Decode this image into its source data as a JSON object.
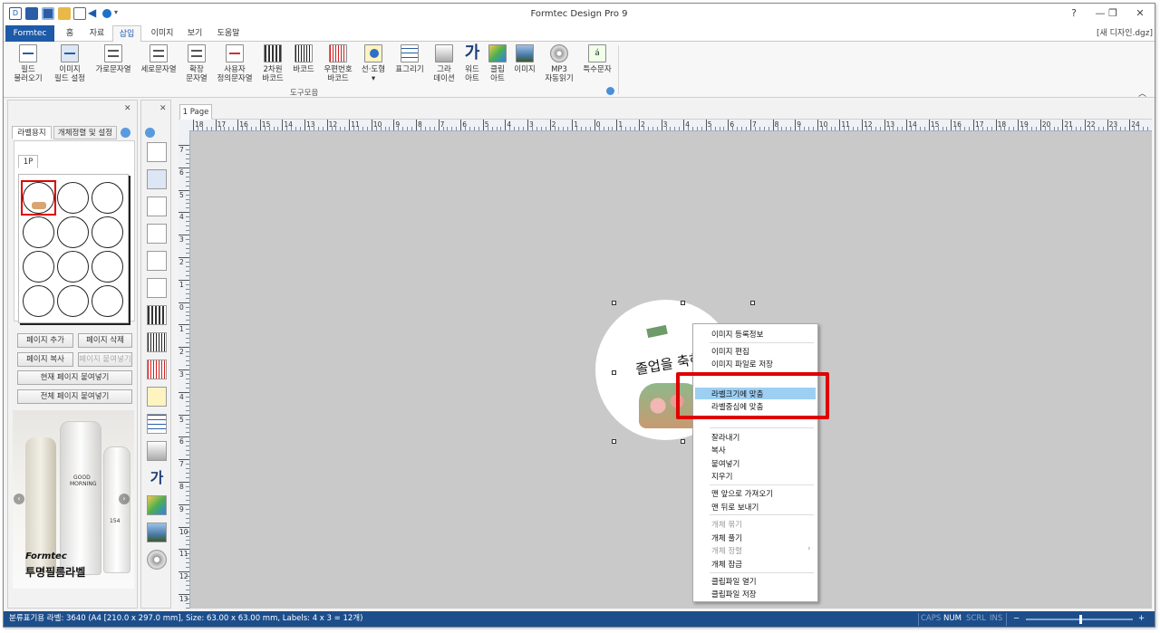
{
  "window": {
    "title": "Formtec Design Pro 9",
    "controls": [
      "?",
      "—",
      "❐",
      "✕"
    ],
    "document_name": "[새 디자인.dgz]"
  },
  "tabs": [
    {
      "label": "Formtec"
    },
    {
      "label": "홈"
    },
    {
      "label": "자료"
    },
    {
      "label": "삽입"
    },
    {
      "label": "이미지"
    },
    {
      "label": "보기"
    },
    {
      "label": "도움말"
    }
  ],
  "ribbon": {
    "buttons": [
      {
        "label1": "필드",
        "label2": "불러오기",
        "icon": "field-load-icon"
      },
      {
        "label1": "이미지",
        "label2": "필드 설정",
        "icon": "image-field-icon"
      },
      {
        "label1": "가로문자열",
        "label2": "",
        "icon": "horizontal-text-icon"
      },
      {
        "label1": "세로문자열",
        "label2": "",
        "icon": "vertical-text-icon"
      },
      {
        "label1": "확장",
        "label2": "문자열",
        "icon": "extended-text-icon"
      },
      {
        "label1": "사용자",
        "label2": "정의문자열",
        "icon": "custom-text-icon"
      },
      {
        "label1": "2차원",
        "label2": "바코드",
        "icon": "qr-code-icon"
      },
      {
        "label1": "바코드",
        "label2": "",
        "icon": "barcode-icon"
      },
      {
        "label1": "우편번호",
        "label2": "바코드",
        "icon": "postal-barcode-icon"
      },
      {
        "label1": "선·도형",
        "label2": "▾",
        "icon": "shape-icon"
      },
      {
        "label1": "표그리기",
        "label2": "",
        "icon": "table-icon"
      },
      {
        "label1": "그라",
        "label2": "데이션",
        "icon": "gradient-icon"
      },
      {
        "label1": "워드",
        "label2": "아트",
        "icon": "word-art-icon"
      },
      {
        "label1": "클립",
        "label2": "아트",
        "icon": "clip-art-icon"
      },
      {
        "label1": "이미지",
        "label2": "",
        "icon": "image-icon"
      },
      {
        "label1": "MP3",
        "label2": "자동읽기",
        "icon": "mp3-icon"
      },
      {
        "label1": "특수문자",
        "label2": "",
        "icon": "special-char-icon"
      }
    ],
    "group_label": "도구모음"
  },
  "left_panel": {
    "tabs": [
      "라벨용지",
      "개체정렬 및 설정"
    ],
    "page_tab": "1P",
    "buttons": [
      "페이지 추가",
      "페이지 삭제",
      "페이지 복사",
      "페이지 붙여넣기",
      "현재 페이지 붙여넣기",
      "전체 페이지 붙여넣기"
    ],
    "ad": {
      "brand": "Formtec",
      "caption": "투명필름라벨",
      "bottle_text1": "GOOD",
      "bottle_text2": "MORNING",
      "bottle_num": "154"
    }
  },
  "document_tab": "1 Page",
  "ruler": {
    "h_labels": [
      "18",
      "17",
      "16",
      "15",
      "14",
      "13",
      "12",
      "11",
      "10",
      "9",
      "8",
      "7",
      "6",
      "5",
      "4",
      "3",
      "2",
      "1",
      "0",
      "1",
      "2",
      "3",
      "4",
      "5",
      "6",
      "7",
      "8",
      "9",
      "10",
      "11",
      "12",
      "13",
      "14",
      "15",
      "16",
      "17",
      "18",
      "19",
      "20",
      "21",
      "22",
      "23",
      "24"
    ],
    "v_labels": [
      "7",
      "6",
      "5",
      "4",
      "3",
      "2",
      "1",
      "0",
      "1",
      "2",
      "3",
      "4",
      "5",
      "6",
      "7",
      "8",
      "9",
      "10",
      "11",
      "12",
      "13"
    ]
  },
  "label_art_text": "졸업을 축하",
  "context_menu": {
    "items": [
      {
        "label": "이미지 등록정보",
        "disabled": false
      },
      {
        "label": "이미지 편집",
        "disabled": false
      },
      {
        "label": "이미지 파일로 저장",
        "disabled": false
      },
      {
        "label": "라벨크기에 맞춤",
        "disabled": false,
        "highlighted": true
      },
      {
        "label": "라벨중심에 맞춤",
        "disabled": false
      },
      {
        "label": "잘라내기",
        "disabled": false
      },
      {
        "label": "복사",
        "disabled": false
      },
      {
        "label": "붙여넣기",
        "disabled": false
      },
      {
        "label": "지우기",
        "disabled": false
      },
      {
        "label": "맨 앞으로 가져오기",
        "disabled": false
      },
      {
        "label": "맨 뒤로 보내기",
        "disabled": false
      },
      {
        "label": "개체 묶기",
        "disabled": true
      },
      {
        "label": "개체 풀기",
        "disabled": false
      },
      {
        "label": "개체 정렬",
        "disabled": true
      },
      {
        "label": "개체 잠금",
        "disabled": false
      },
      {
        "label": "클립파일 열기",
        "disabled": false
      },
      {
        "label": "클립파일 저장",
        "disabled": false
      }
    ],
    "submenu_arrow": "›"
  },
  "status_bar": {
    "info": "분류표기용 라벨: 3640 (A4 [210.0 x 297.0 mm], Size: 63.00 x 63.00 mm,  Labels: 4 x 3 = 12개)",
    "indicators": [
      {
        "label": "CAPS",
        "active": false
      },
      {
        "label": "NUM",
        "active": true
      },
      {
        "label": "SCRL",
        "active": false
      },
      {
        "label": "INS",
        "active": false
      }
    ],
    "zoom_minus": "−",
    "zoom_plus": "+",
    "zoom_level": 0.5
  },
  "colors": {
    "brand_blue": "#1d5aa8",
    "status_bar": "#1c4e8c",
    "highlight": "#9dcff3",
    "callout_red": "#e00000"
  }
}
